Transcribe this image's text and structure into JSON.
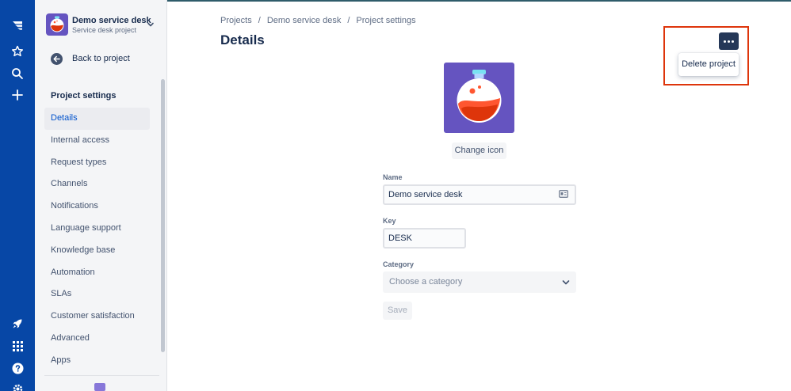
{
  "colors": {
    "global_nav": "#0747a6",
    "sidebar_bg": "#f4f5f7",
    "active_link": "#0052cc",
    "project_icon_bg": "#6554c0",
    "highlight": "#de350b"
  },
  "global_nav": {
    "icons": [
      "jira-logo-icon",
      "star-icon",
      "search-icon",
      "plus-icon",
      "rocket-icon",
      "app-switcher-icon",
      "help-icon",
      "settings-icon"
    ]
  },
  "project": {
    "name": "Demo service desk",
    "type": "Service desk project"
  },
  "sidebar": {
    "back_label": "Back to project",
    "heading": "Project settings",
    "items": [
      {
        "label": "Details",
        "active": true
      },
      {
        "label": "Internal access"
      },
      {
        "label": "Request types"
      },
      {
        "label": "Channels"
      },
      {
        "label": "Notifications"
      },
      {
        "label": "Language support"
      },
      {
        "label": "Knowledge base"
      },
      {
        "label": "Automation"
      },
      {
        "label": "SLAs"
      },
      {
        "label": "Customer satisfaction"
      },
      {
        "label": "Advanced"
      },
      {
        "label": "Apps"
      }
    ]
  },
  "breadcrumb": [
    "Projects",
    "Demo service desk",
    "Project settings"
  ],
  "page_title": "Details",
  "form": {
    "change_icon_label": "Change icon",
    "name_label": "Name",
    "name_value": "Demo service desk",
    "key_label": "Key",
    "key_value": "DESK",
    "category_label": "Category",
    "category_placeholder": "Choose a category",
    "save_label": "Save"
  },
  "actions_menu": {
    "delete_label": "Delete project"
  }
}
